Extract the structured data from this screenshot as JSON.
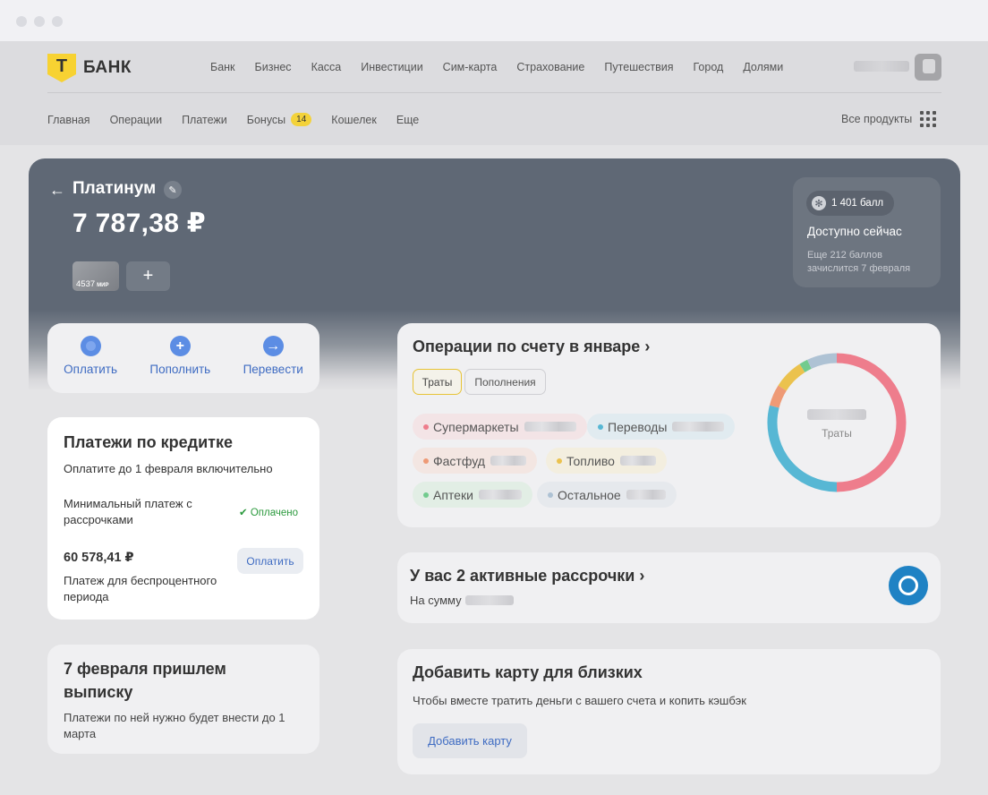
{
  "brand": {
    "logo_letter": "Т",
    "name": "БАНК",
    "color": "#f7d232"
  },
  "top_nav": [
    "Банк",
    "Бизнес",
    "Касса",
    "Инвестиции",
    "Сим-карта",
    "Страхование",
    "Путешествия",
    "Город",
    "Долями"
  ],
  "sub_nav": {
    "items": [
      {
        "label": "Главная"
      },
      {
        "label": "Операции"
      },
      {
        "label": "Платежи"
      },
      {
        "label": "Бонусы",
        "badge": "14"
      },
      {
        "label": "Кошелек"
      },
      {
        "label": "Еще"
      }
    ],
    "all_products": "Все продукты"
  },
  "account": {
    "back_icon": "arrow-left-icon",
    "name": "Платинум",
    "balance": "7 787,38 ₽",
    "card_last4": "4537",
    "card_system": "МИР",
    "add_card_label": "+"
  },
  "points": {
    "amount": "1 401 балл",
    "available": "Доступно сейчас",
    "pending": "Еще 212 баллов зачислится 7 февраля"
  },
  "actions": [
    {
      "label": "Оплатить",
      "icon": "circle-icon"
    },
    {
      "label": "Пополнить",
      "icon": "plus-icon"
    },
    {
      "label": "Перевести",
      "icon": "arrow-right-icon"
    }
  ],
  "credit_payments": {
    "title": "Платежи по кредитке",
    "deadline": "Оплатите до 1 февраля включительно",
    "min_payment_label": "Минимальный платеж с рассрочками",
    "min_payment_status": "Оплачено",
    "amount": "60 578,41 ₽",
    "amount_desc": "Платеж для беспроцентного периода",
    "pay_button": "Оплатить"
  },
  "statement": {
    "title": "7 февраля пришлем выписку",
    "desc": "Платежи по ней нужно будет внести до 1 марта"
  },
  "operations": {
    "title": "Операции по счету в январе",
    "tabs": [
      "Траты",
      "Пополнения"
    ],
    "categories": [
      {
        "name": "Супермаркеты",
        "color": "#ee7d8c",
        "share": 0.5
      },
      {
        "name": "Переводы",
        "color": "#57b7d4",
        "share": 0.29
      },
      {
        "name": "Фастфуд",
        "color": "#ee9a76",
        "share": 0.05
      },
      {
        "name": "Топливо",
        "color": "#ebc24e",
        "share": 0.07
      },
      {
        "name": "Аптеки",
        "color": "#72cb8e",
        "share": 0.02
      },
      {
        "name": "Остальное",
        "color": "#aec2d4",
        "share": 0.07
      }
    ],
    "donut_label": "Траты"
  },
  "installments": {
    "title": "У вас 2 активные рассрочки",
    "sum_label": "На сумму"
  },
  "family_card": {
    "title": "Добавить карту для близких",
    "desc": "Чтобы вместе тратить деньги с вашего счета и копить кэшбэк",
    "button": "Добавить карту"
  }
}
